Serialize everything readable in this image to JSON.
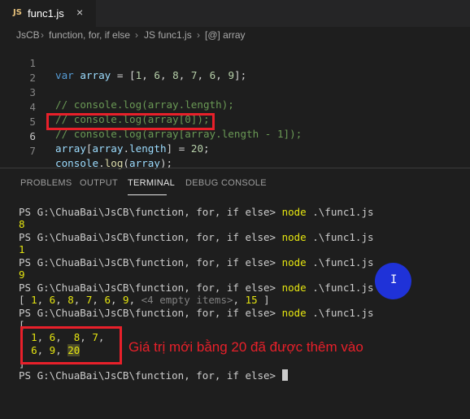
{
  "tab": {
    "badge": "JS",
    "title": "func1.js",
    "close": "×"
  },
  "breadcrumb": {
    "items": [
      "JsCB",
      "function, for, if else",
      "JS func1.js",
      "[@] array"
    ],
    "separator": "›"
  },
  "editor": {
    "lines": [
      {
        "num": "1"
      },
      {
        "num": "2"
      },
      {
        "num": "3"
      },
      {
        "num": "4"
      },
      {
        "num": "5"
      },
      {
        "num": "6"
      },
      {
        "num": "7"
      }
    ],
    "code": {
      "l1_kw": "var",
      "l1_var": "array",
      "l1_rest_a": " = [",
      "l1_n1": "1",
      "l1_n2": "6",
      "l1_n3": "8",
      "l1_n4": "7",
      "l1_n5": "6",
      "l1_n6": "9",
      "l1_end": "];",
      "l3": "// console.log(array.length);",
      "l4": "// console.log(array[0]);",
      "l5": "// console.log(array[array.length - 1]);",
      "l6_a": "array",
      "l6_b": "[",
      "l6_c": "array",
      "l6_d": ".",
      "l6_e": "length",
      "l6_f": "] = ",
      "l6_g": "20",
      "l6_h": ";",
      "l7_a": "console",
      "l7_b": ".",
      "l7_c": "log",
      "l7_d": "(",
      "l7_e": "array",
      "l7_f": ");"
    }
  },
  "panel": {
    "tabs": [
      "PROBLEMS",
      "OUTPUT",
      "TERMINAL",
      "DEBUG CONSOLE"
    ],
    "active_tab": "TERMINAL"
  },
  "terminal": {
    "prompt": "PS G:\\ChuaBai\\JsCB\\function, for, if else>",
    "cmd": "node",
    "arg": ".\\func1.js",
    "out1": "8",
    "out2": "1",
    "out3": "9",
    "out4_a": "[ ",
    "out4_b": "1",
    "out4_c": ", ",
    "out4_d": "6",
    "out4_e": "8",
    "out4_f": "7",
    "out4_g": "9",
    "out4_h": "<4 empty items>",
    "out4_i": "15",
    "out4_j": " ]",
    "out5_open": "[",
    "out5_l1": [
      "1",
      "6",
      "8",
      "7"
    ],
    "out5_l2": [
      "6",
      "9",
      "20"
    ],
    "out5_close": "]"
  },
  "annotation": "Giá trị mới bằng 20 đã được thêm vào",
  "colors": {
    "accent_red": "#e8202a",
    "cursor_blue": "#1f32d8"
  }
}
